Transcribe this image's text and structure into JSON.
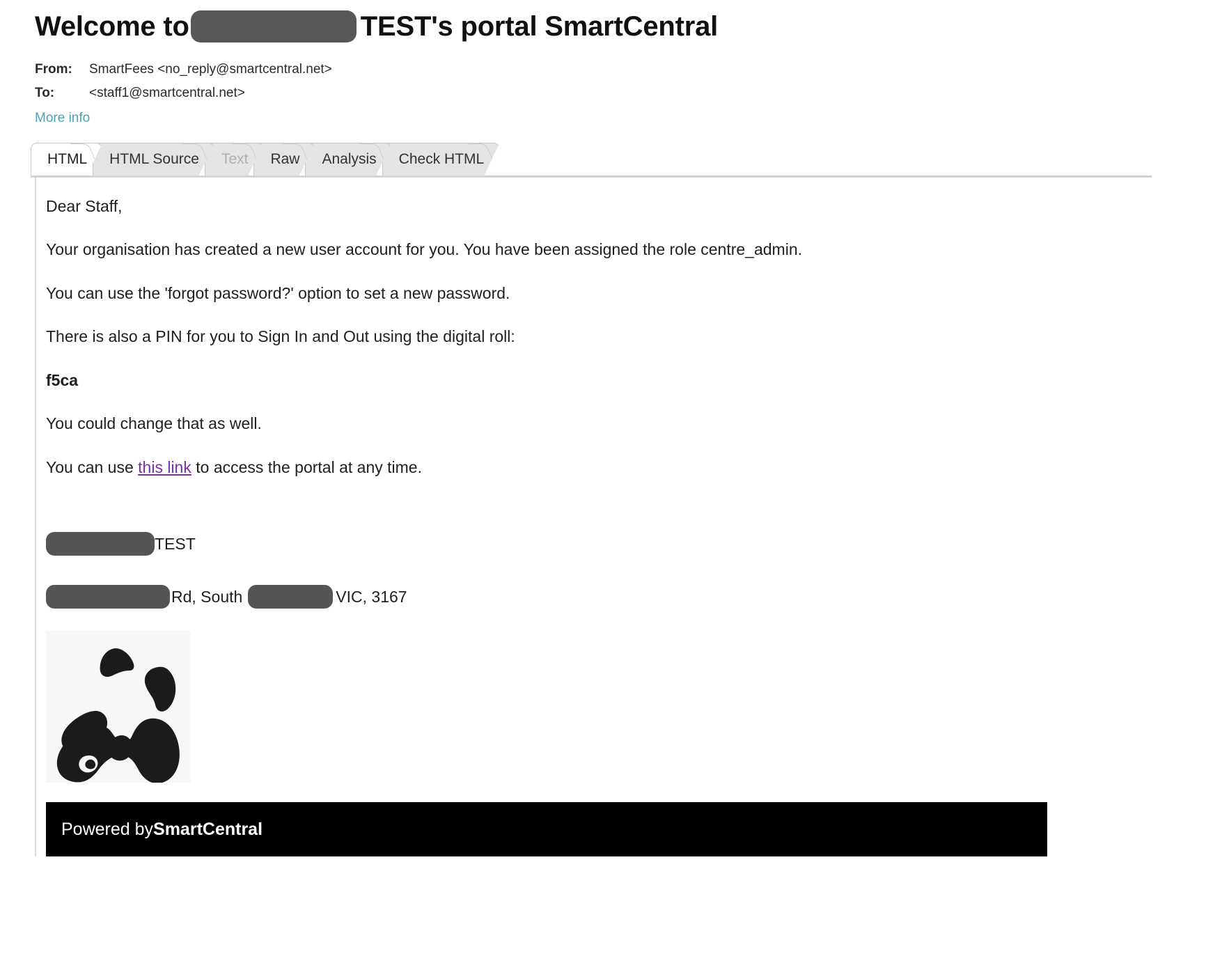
{
  "email": {
    "subject_prefix": "Welcome to",
    "subject_suffix": "TEST's portal SmartCentral",
    "from_label": "From:",
    "from_value": "SmartFees <no_reply@smartcentral.net>",
    "to_label": "To:",
    "to_value": "<staff1@smartcentral.net>",
    "more_info": "More info"
  },
  "tabs": [
    {
      "label": "HTML",
      "active": true,
      "disabled": false
    },
    {
      "label": "HTML Source",
      "active": false,
      "disabled": false
    },
    {
      "label": "Text",
      "active": false,
      "disabled": true
    },
    {
      "label": "Raw",
      "active": false,
      "disabled": false
    },
    {
      "label": "Analysis",
      "active": false,
      "disabled": false
    },
    {
      "label": "Check HTML",
      "active": false,
      "disabled": false
    }
  ],
  "body": {
    "greeting": "Dear Staff,",
    "p1": "Your organisation has created a new user account for you. You have been assigned the role centre_admin.",
    "p2": "You can use the 'forgot password?' option to set a new password.",
    "p3": "There is also a PIN for you to Sign In and Out using the digital roll:",
    "pin": "f5ca",
    "p4": "You could change that as well.",
    "p5_before": "You can use ",
    "p5_link": "this link",
    "p5_after": " to access the portal at any time."
  },
  "signature": {
    "org_suffix": "TEST",
    "address_part1": "Rd, South",
    "address_part2": "VIC, 3167",
    "logo_icon": "panda-logo-icon"
  },
  "footer": {
    "powered_by": "Powered by ",
    "brand": "SmartCentral"
  },
  "colors": {
    "link": "#4aa3b0",
    "visited_link": "#7b2ea8",
    "redaction": "#555555",
    "footer_bg": "#000000",
    "tab_inactive": "#e4e4e4",
    "tab_active": "#ffffff"
  }
}
